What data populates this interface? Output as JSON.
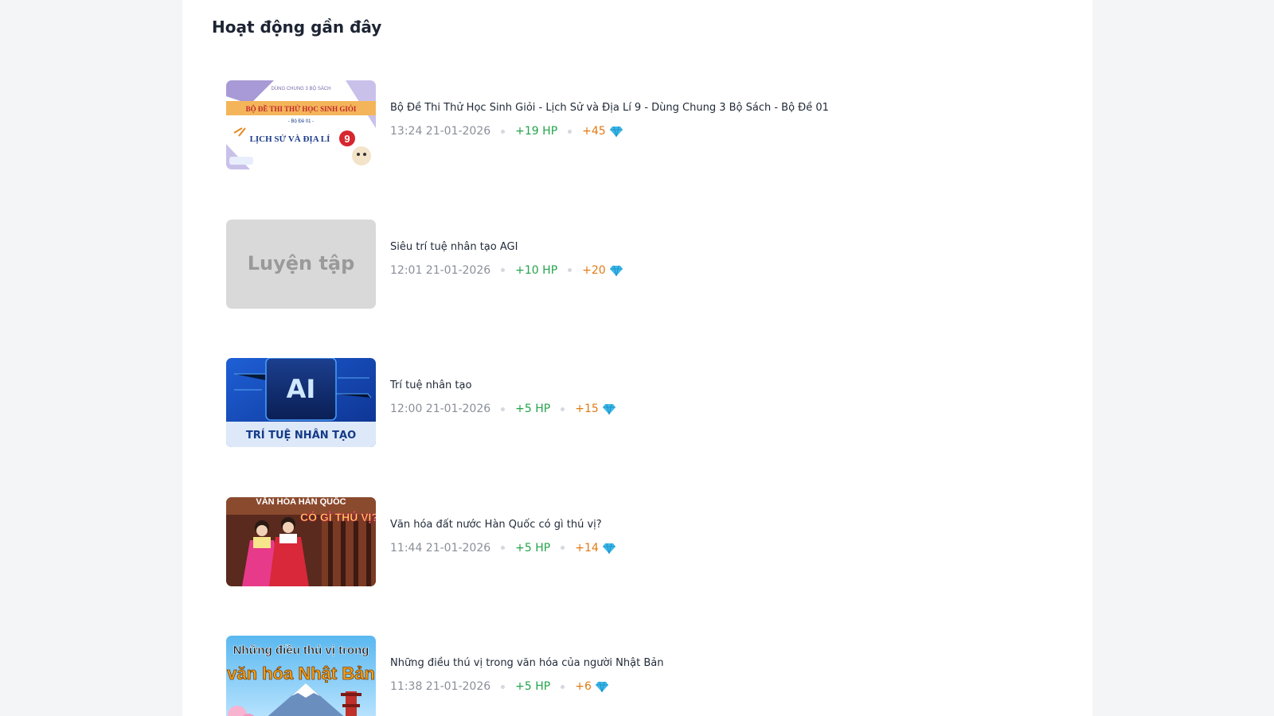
{
  "section": {
    "title": "Hoạt động gần đây"
  },
  "activities": [
    {
      "title": "Bộ Đề Thi Thử Học Sinh Giỏi - Lịch Sử và Địa Lí 9 - Dùng Chung 3 Bộ Sách - Bộ Đề 01",
      "time": "13:24 21-01-2026",
      "hp": "+19 HP",
      "gems": "+45",
      "thumb": {
        "type": "history-exam",
        "top_text": "DÙNG CHUNG 3 BỘ SÁCH",
        "banner": "BỘ ĐỀ THI THỬ HỌC SINH GIỎI",
        "sub": "- Bộ Đề 01 -",
        "subject": "LỊCH SỬ VÀ ĐỊA LÍ",
        "grade": "9"
      }
    },
    {
      "title": "Siêu trí tuệ nhân tạo AGI",
      "time": "12:01 21-01-2026",
      "hp": "+10 HP",
      "gems": "+20",
      "thumb": {
        "type": "placeholder",
        "label": "Luyện tập"
      }
    },
    {
      "title": "Trí tuệ nhân tạo",
      "time": "12:00 21-01-2026",
      "hp": "+5 HP",
      "gems": "+15",
      "thumb": {
        "type": "ai-chip",
        "chip_text": "AI",
        "caption": "TRÍ TUỆ NHÂN TẠO"
      }
    },
    {
      "title": "Văn hóa đất nước Hàn Quốc có gì thú vị?",
      "time": "11:44 21-01-2026",
      "hp": "+5 HP",
      "gems": "+14",
      "thumb": {
        "type": "korea",
        "line1": "VĂN HÓA HÀN QUỐC",
        "line2": "CÓ GÌ THÚ VỊ?"
      }
    },
    {
      "title": "Những điều thú vị trong văn hóa của người Nhật Bản",
      "time": "11:38 21-01-2026",
      "hp": "+5 HP",
      "gems": "+6",
      "thumb": {
        "type": "japan",
        "line1": "Những điều thú vị trong",
        "line2": "văn hóa Nhật Bản"
      }
    }
  ],
  "colors": {
    "hp": "#22a34a",
    "gems": "#e07a14",
    "time": "#8a8f99",
    "title": "#1f2937",
    "gem_icon": "#3bb8e8"
  },
  "icons": {
    "gem": "diamond-icon"
  }
}
